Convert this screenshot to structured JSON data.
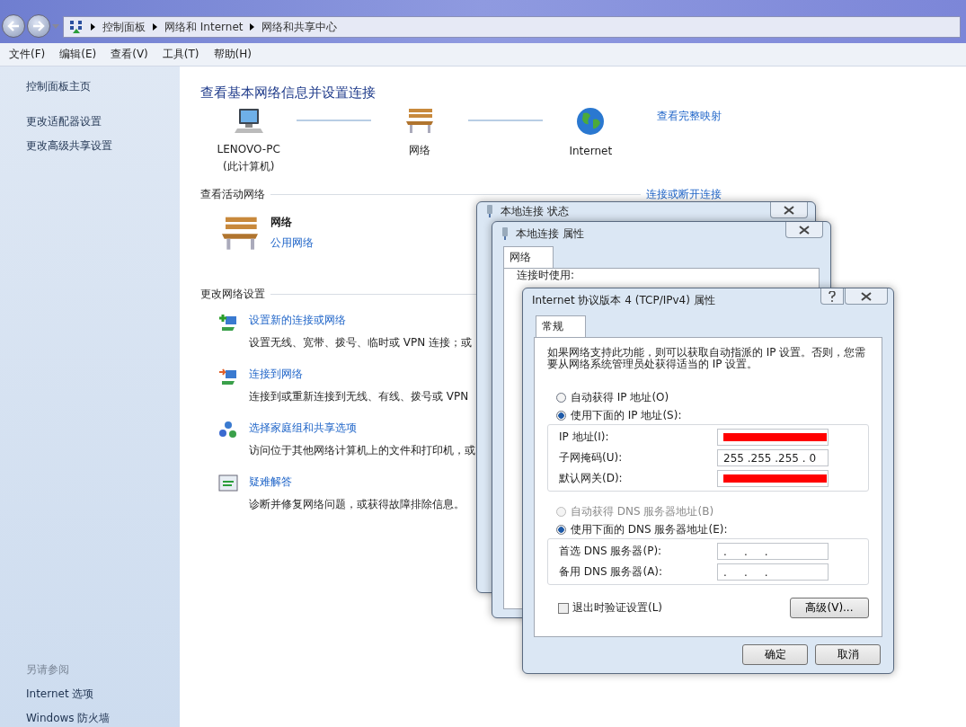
{
  "nav": {
    "breadcrumbs": [
      "控制面板",
      "网络和 Internet",
      "网络和共享中心"
    ]
  },
  "menu": [
    "文件(F)",
    "编辑(E)",
    "查看(V)",
    "工具(T)",
    "帮助(H)"
  ],
  "sidebar": {
    "items": [
      "控制面板主页",
      "更改适配器设置",
      "更改高级共享设置"
    ],
    "see_also_title": "另请参阅",
    "see_also": [
      "Internet 选项",
      "Windows 防火墙"
    ]
  },
  "main": {
    "title": "查看基本网络信息并设置连接",
    "map": {
      "nodes": [
        {
          "kind": "computer",
          "label": "LENOVO-PC",
          "sublabel": "(此计算机)"
        },
        {
          "kind": "bench",
          "label": "网络"
        },
        {
          "kind": "globe",
          "label": "Internet"
        }
      ],
      "link": "查看完整映射"
    },
    "active": {
      "heading": "查看活动网络",
      "link": "连接或断开连接",
      "network_name": "网络",
      "network_type": "公用网络"
    },
    "settings": {
      "heading": "更改网络设置",
      "items": [
        {
          "kind": "new",
          "title": "设置新的连接或网络",
          "desc": "设置无线、宽带、拨号、临时或 VPN 连接；或"
        },
        {
          "kind": "connect",
          "title": "连接到网络",
          "desc": "连接到或重新连接到无线、有线、拨号或 VPN"
        },
        {
          "kind": "homegroup",
          "title": "选择家庭组和共享选项",
          "desc": "访问位于其他网络计算机上的文件和打印机，或"
        },
        {
          "kind": "troubleshoot",
          "title": "疑难解答",
          "desc": "诊断并修复网络问题，或获得故障排除信息。"
        }
      ]
    }
  },
  "dialogs": {
    "status": {
      "title": "本地连接 状态"
    },
    "properties": {
      "title": "本地连接 属性",
      "tabs": [
        {
          "label": "网络",
          "selected": true
        }
      ],
      "field_label": "连接时使用:"
    },
    "ipv4": {
      "title": "Internet 协议版本 4 (TCP/IPv4) 属性",
      "tabs": [
        {
          "label": "常规",
          "selected": true
        }
      ],
      "intro": "如果网络支持此功能，则可以获取自动指派的 IP 设置。否则，您需要从网络系统管理员处获得适当的 IP 设置。",
      "ip_options": [
        {
          "label": "自动获得 IP 地址(O)",
          "selected": false,
          "disabled": false
        },
        {
          "label": "使用下面的 IP 地址(S):",
          "selected": true,
          "disabled": false
        }
      ],
      "ip_fields": [
        {
          "label": "IP 地址(I):",
          "redacted": true
        },
        {
          "label": "子网掩码(U):",
          "value": "255 .255 .255 . 0",
          "redacted": false
        },
        {
          "label": "默认网关(D):",
          "redacted": true
        }
      ],
      "dns_options": [
        {
          "label": "自动获得 DNS 服务器地址(B)",
          "selected": false,
          "disabled": true
        },
        {
          "label": "使用下面的 DNS 服务器地址(E):",
          "selected": true,
          "disabled": false
        }
      ],
      "dns_fields": [
        {
          "label": "首选 DNS 服务器(P):",
          "value": ".     .     .",
          "redacted": false
        },
        {
          "label": "备用 DNS 服务器(A):",
          "value": ".     .     .",
          "redacted": false
        }
      ],
      "validate": {
        "label": "退出时验证设置(L)",
        "checked": false
      },
      "advanced_button": "高级(V)...",
      "buttons": [
        "确定",
        "取消"
      ]
    }
  }
}
